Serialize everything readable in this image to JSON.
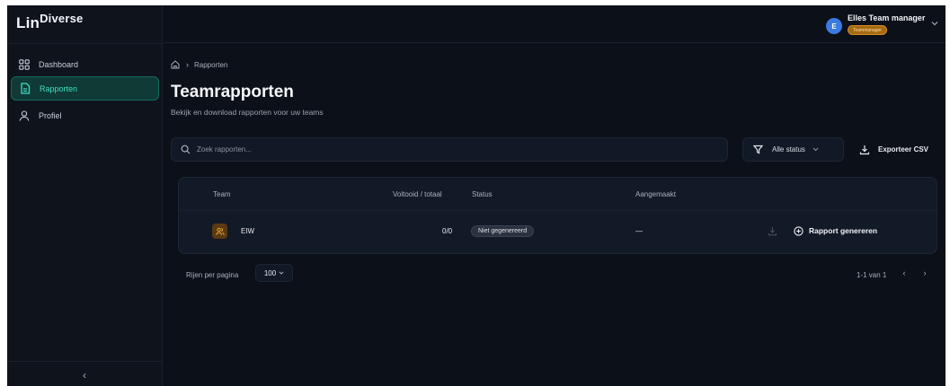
{
  "app": {
    "logo_main": "Lin",
    "logo_sup": "Diverse"
  },
  "sidebar": {
    "items": [
      {
        "label": "Dashboard",
        "icon": "grid-icon",
        "active": false
      },
      {
        "label": "Rapporten",
        "icon": "document-icon",
        "active": true
      },
      {
        "label": "Profiel",
        "icon": "user-icon",
        "active": false
      }
    ],
    "collapse_glyph": "‹"
  },
  "user": {
    "initial": "E",
    "name": "Elles Team manager",
    "role": "Teammanager"
  },
  "breadcrumb": {
    "current": "Rapporten"
  },
  "page": {
    "title": "Teamrapporten",
    "subtitle": "Bekijk en download rapporten voor uw teams"
  },
  "search": {
    "placeholder": "Zoek rapporten..."
  },
  "filter": {
    "label": "Alle status"
  },
  "export": {
    "label": "Exporteer CSV"
  },
  "table": {
    "headers": {
      "team": "Team",
      "voltooid": "Voltooid / totaal",
      "status": "Status",
      "aangemaakt": "Aangemaakt"
    },
    "rows": [
      {
        "team": "EIW",
        "voltooid": "0/0",
        "status": "Niet gegenereerd",
        "aangemaakt": "—",
        "action": "Rapport genereren"
      }
    ]
  },
  "pagination": {
    "rows_label": "Rijen per pagina",
    "rows_value": "100",
    "range": "1-1 van 1",
    "prev_glyph": "‹",
    "next_glyph": "›"
  },
  "colors": {
    "accent": "#3fe0c3",
    "role_badge": "#a66a12",
    "avatar": "#3b7ae0"
  }
}
